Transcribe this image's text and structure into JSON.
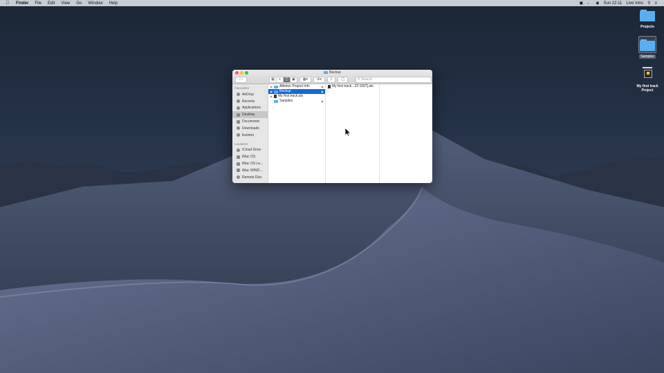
{
  "menubar": {
    "app_name": "Finder",
    "items": [
      "File",
      "Edit",
      "View",
      "Go",
      "Window",
      "Help"
    ],
    "clock": "Sun 22:11",
    "user": "Live Intro"
  },
  "desktop_icons": [
    {
      "label": "Projects"
    },
    {
      "label": "Samples"
    },
    {
      "label": "My first track Project"
    }
  ],
  "finder": {
    "title": "Backup",
    "search_placeholder": "Search",
    "sidebar": {
      "favourites_header": "Favourites",
      "favourites": [
        "AirDrop",
        "Recents",
        "Applications",
        "Desktop",
        "Documents",
        "Downloads",
        "liveintro"
      ],
      "locations_header": "Locations",
      "locations": [
        "iCloud Drive",
        "iMac OS",
        "iMac OS Le...",
        "iMac WIND...",
        "Remote Disc"
      ]
    },
    "column1": [
      {
        "name": "Ableton Project Info",
        "kind": "folder"
      },
      {
        "name": "Backup",
        "kind": "folder"
      },
      {
        "name": "My first track.als",
        "kind": "file"
      },
      {
        "name": "Samples",
        "kind": "folder"
      }
    ],
    "column2": [
      {
        "name": "My first track...22:1007].als",
        "kind": "file"
      }
    ]
  },
  "colors": {
    "selection": "#1569d6",
    "folder": "#5aaef0"
  }
}
